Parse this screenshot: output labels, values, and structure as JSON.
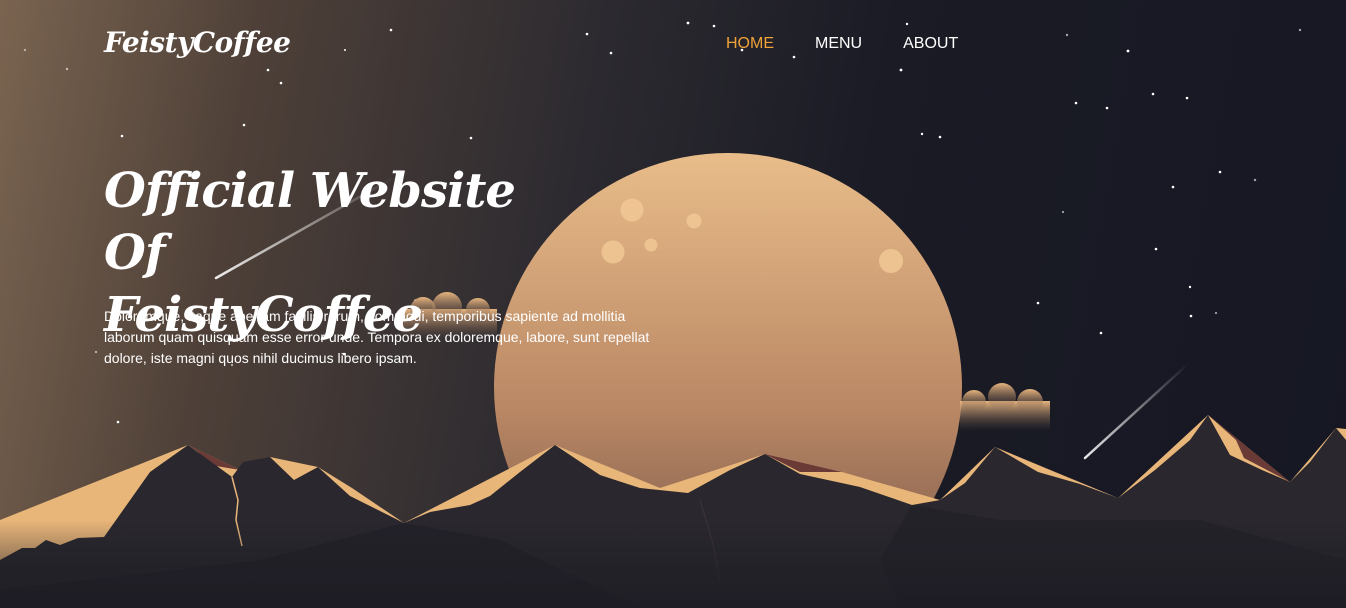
{
  "header": {
    "logo": "FeistyCoffee",
    "nav": [
      {
        "label": "HOME",
        "active": true
      },
      {
        "label": "MENU",
        "active": false
      },
      {
        "label": "ABOUT",
        "active": false
      }
    ]
  },
  "hero": {
    "title_line1": "Official Website Of",
    "title_line2": "FeistyCoffee",
    "text": "Doloremque, itaque aperiam facilis rerum, commodi, temporibus sapiente ad mollitia laborum quam quisquam esse error unde. Tempora ex doloremque, labore, sunt repellat dolore, iste magni quos nihil ducimus libero ipsam."
  },
  "colors": {
    "accent": "#f0a238",
    "moon": "#e7b988",
    "mountain_dark": "#2a282e",
    "mountain_light": "#e9b67a",
    "sky_dark": "#161723"
  }
}
